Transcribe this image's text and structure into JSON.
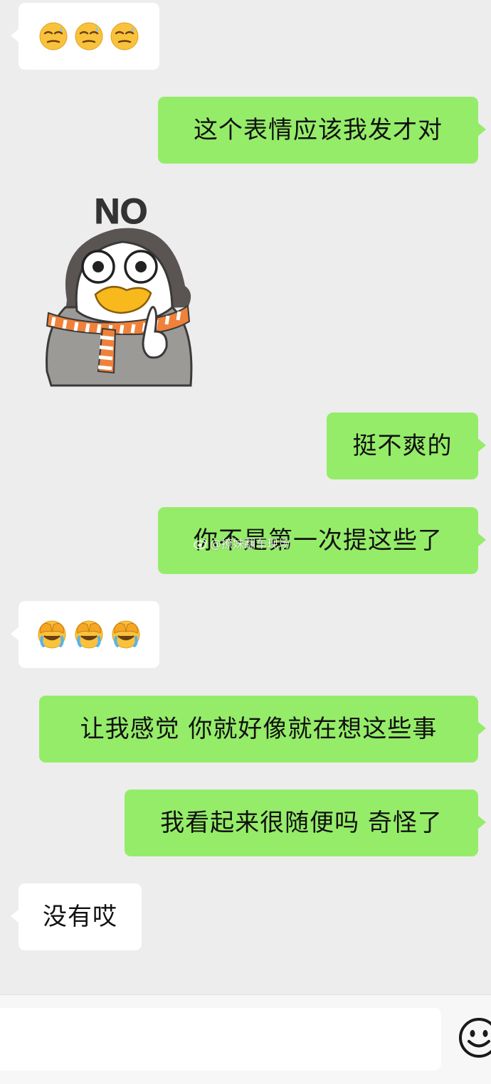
{
  "messages": [
    {
      "from": "other",
      "type": "emoji",
      "emoji": [
        "smirk-sweat-emoji",
        "smirk-sweat-emoji",
        "smirk-sweat-emoji"
      ]
    },
    {
      "from": "me",
      "type": "text",
      "text": "这个表情应该我发才对"
    },
    {
      "from": "other",
      "type": "sticker",
      "sticker_text": "NO",
      "sticker": "penguin-no-sticker"
    },
    {
      "from": "me",
      "type": "text",
      "text": "挺不爽的"
    },
    {
      "from": "me",
      "type": "text",
      "text": "你不是第一次提这些了"
    },
    {
      "from": "other",
      "type": "emoji",
      "emoji": [
        "facepalm-cry-emoji",
        "facepalm-cry-emoji",
        "facepalm-cry-emoji"
      ]
    },
    {
      "from": "me",
      "type": "text",
      "text": "让我感觉 你就好像就在想这些事"
    },
    {
      "from": "me",
      "type": "text",
      "text": "我看起来很随便吗 奇怪了"
    },
    {
      "from": "other",
      "type": "text",
      "text": "没有哎"
    }
  ],
  "watermark": "@撩妹翻车现场",
  "input": {
    "value": ""
  },
  "colors": {
    "background": "#ededed",
    "outgoing_bubble": "#95ec69",
    "incoming_bubble": "#ffffff",
    "input_bar": "#f7f7f7"
  },
  "icons": {
    "input_right": "emoji-face-icon"
  }
}
